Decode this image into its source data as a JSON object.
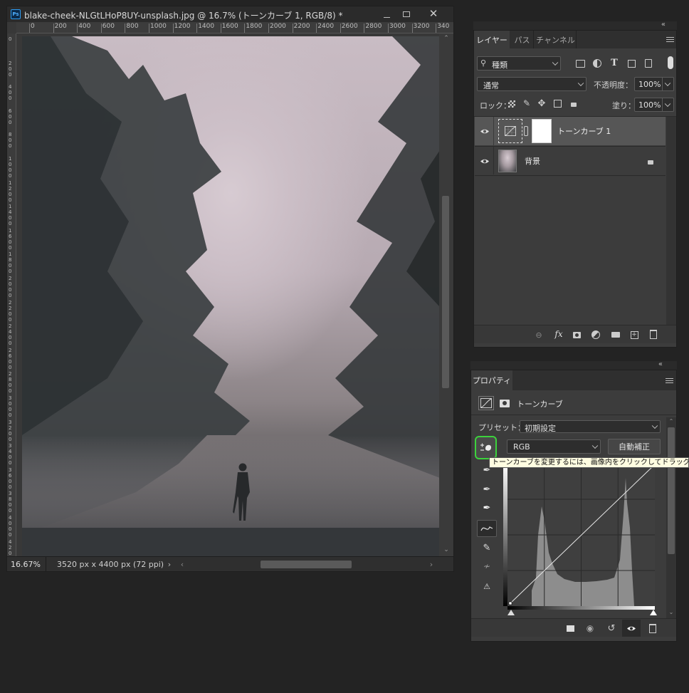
{
  "document": {
    "title": "blake-cheek-NLGtLHoP8UY-unsplash.jpg @ 16.7% (トーンカーブ 1, RGB/8) *",
    "app_icon": "Ps",
    "ruler_labels": [
      "0",
      "200",
      "400",
      "600",
      "800",
      "1000",
      "1200",
      "1400",
      "1600",
      "1800",
      "2000",
      "2200",
      "2400",
      "2600",
      "2800",
      "3000",
      "3200",
      "340"
    ],
    "ruler_left_labels": [
      "0",
      "2\n0\n0",
      "4\n0\n0",
      "6\n0\n0",
      "8\n0\n0",
      "1\n0\n0\n0",
      "1\n2\n0\n0",
      "1\n4\n0\n0",
      "1\n6\n0\n0",
      "1\n8\n0\n0",
      "2\n0\n0\n0",
      "2\n2\n0\n0",
      "2\n4\n0\n0",
      "2\n6\n0\n0",
      "2\n8\n0\n0",
      "3\n0\n0\n0",
      "3\n2\n0\n0",
      "3\n4\n0\n0",
      "3\n6\n0\n0",
      "3\n8\n0\n0",
      "4\n0\n0\n0",
      "4\n2\n0\n0"
    ],
    "zoom": "16.67%",
    "dimensions": "3520 px x 4400 px (72 ppi)"
  },
  "layers_panel": {
    "tabs": [
      "レイヤー",
      "パス",
      "チャンネル"
    ],
    "filter_label": "種類",
    "blend_mode": "通常",
    "opacity_label": "不透明度：",
    "opacity_value": "100%",
    "lock_label": "ロック：",
    "fill_label": "塗り：",
    "fill_value": "100%",
    "layers": [
      {
        "name": "トーンカーブ 1"
      },
      {
        "name": "背景"
      }
    ]
  },
  "properties_panel": {
    "tab": "プロパティ",
    "adjustment_title": "トーンカーブ",
    "preset_label": "プリセット：",
    "preset_value": "初期設定",
    "channel_value": "RGB",
    "auto_button": "自動補正",
    "tooltip": "トーンカーブを変更するには、画像内をクリックしてドラッグし"
  },
  "colors": {
    "highlight": "#3cd23c",
    "tooltip_bg": "#fffde1",
    "panel_bg": "#3c3c3c",
    "app_bg": "#232323"
  }
}
